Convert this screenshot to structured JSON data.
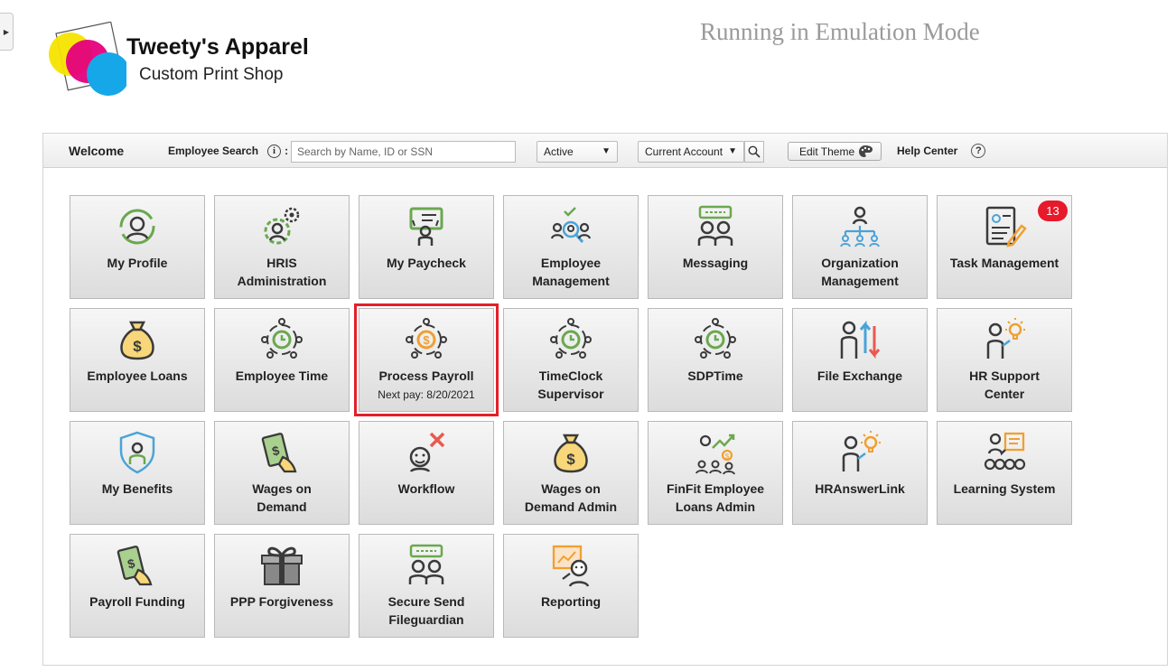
{
  "brand": {
    "title": "Tweety's Apparel",
    "subtitle": "Custom Print Shop"
  },
  "mode_banner": "Running in Emulation Mode",
  "toolbar": {
    "welcome": "Welcome",
    "employee_search_label": "Employee Search",
    "search_placeholder": "Search by Name, ID or SSN",
    "status_selected": "Active",
    "account_selected": "Current Account",
    "edit_theme": "Edit Theme",
    "help_center": "Help Center"
  },
  "tiles": [
    {
      "label": "My Profile",
      "icon": "profile-icon"
    },
    {
      "label": "HRIS Administration",
      "icon": "gear-person-icon"
    },
    {
      "label": "My Paycheck",
      "icon": "paycheck-icon"
    },
    {
      "label": "Employee Management",
      "icon": "employee-search-icon"
    },
    {
      "label": "Messaging",
      "icon": "messaging-icon"
    },
    {
      "label": "Organization Management",
      "icon": "org-chart-icon"
    },
    {
      "label": "Task Management",
      "icon": "task-document-icon",
      "badge": "13"
    },
    {
      "label": "Employee Loans",
      "icon": "money-bag-icon"
    },
    {
      "label": "Employee Time",
      "icon": "clock-people-icon"
    },
    {
      "label": "Process Payroll",
      "icon": "dollar-people-icon",
      "sub": "Next pay: 8/20/2021",
      "selected": true
    },
    {
      "label": "TimeClock Supervisor",
      "icon": "clock-people-icon"
    },
    {
      "label": "SDPTime",
      "icon": "clock-people-icon"
    },
    {
      "label": "File Exchange",
      "icon": "exchange-arrows-icon"
    },
    {
      "label": "HR Support Center",
      "icon": "lightbulb-person-icon"
    },
    {
      "label": "My Benefits",
      "icon": "shield-person-icon"
    },
    {
      "label": "Wages on Demand",
      "icon": "cash-hand-icon"
    },
    {
      "label": "Workflow",
      "icon": "tools-person-icon"
    },
    {
      "label": "Wages on Demand Admin",
      "icon": "money-bag-icon"
    },
    {
      "label": "FinFit Employee Loans Admin",
      "icon": "growth-chart-icon"
    },
    {
      "label": "HRAnswerLink",
      "icon": "lightbulb-person-icon"
    },
    {
      "label": "Learning System",
      "icon": "presentation-icon"
    },
    {
      "label": "Payroll Funding",
      "icon": "cash-hand-icon"
    },
    {
      "label": "PPP Forgiveness",
      "icon": "gift-icon"
    },
    {
      "label": "Secure Send Fileguardian",
      "icon": "messaging-icon"
    },
    {
      "label": "Reporting",
      "icon": "report-person-icon"
    }
  ],
  "colors": {
    "accent_green": "#6aa84f",
    "selected_outline": "#e3202a",
    "badge": "#e8192a"
  }
}
